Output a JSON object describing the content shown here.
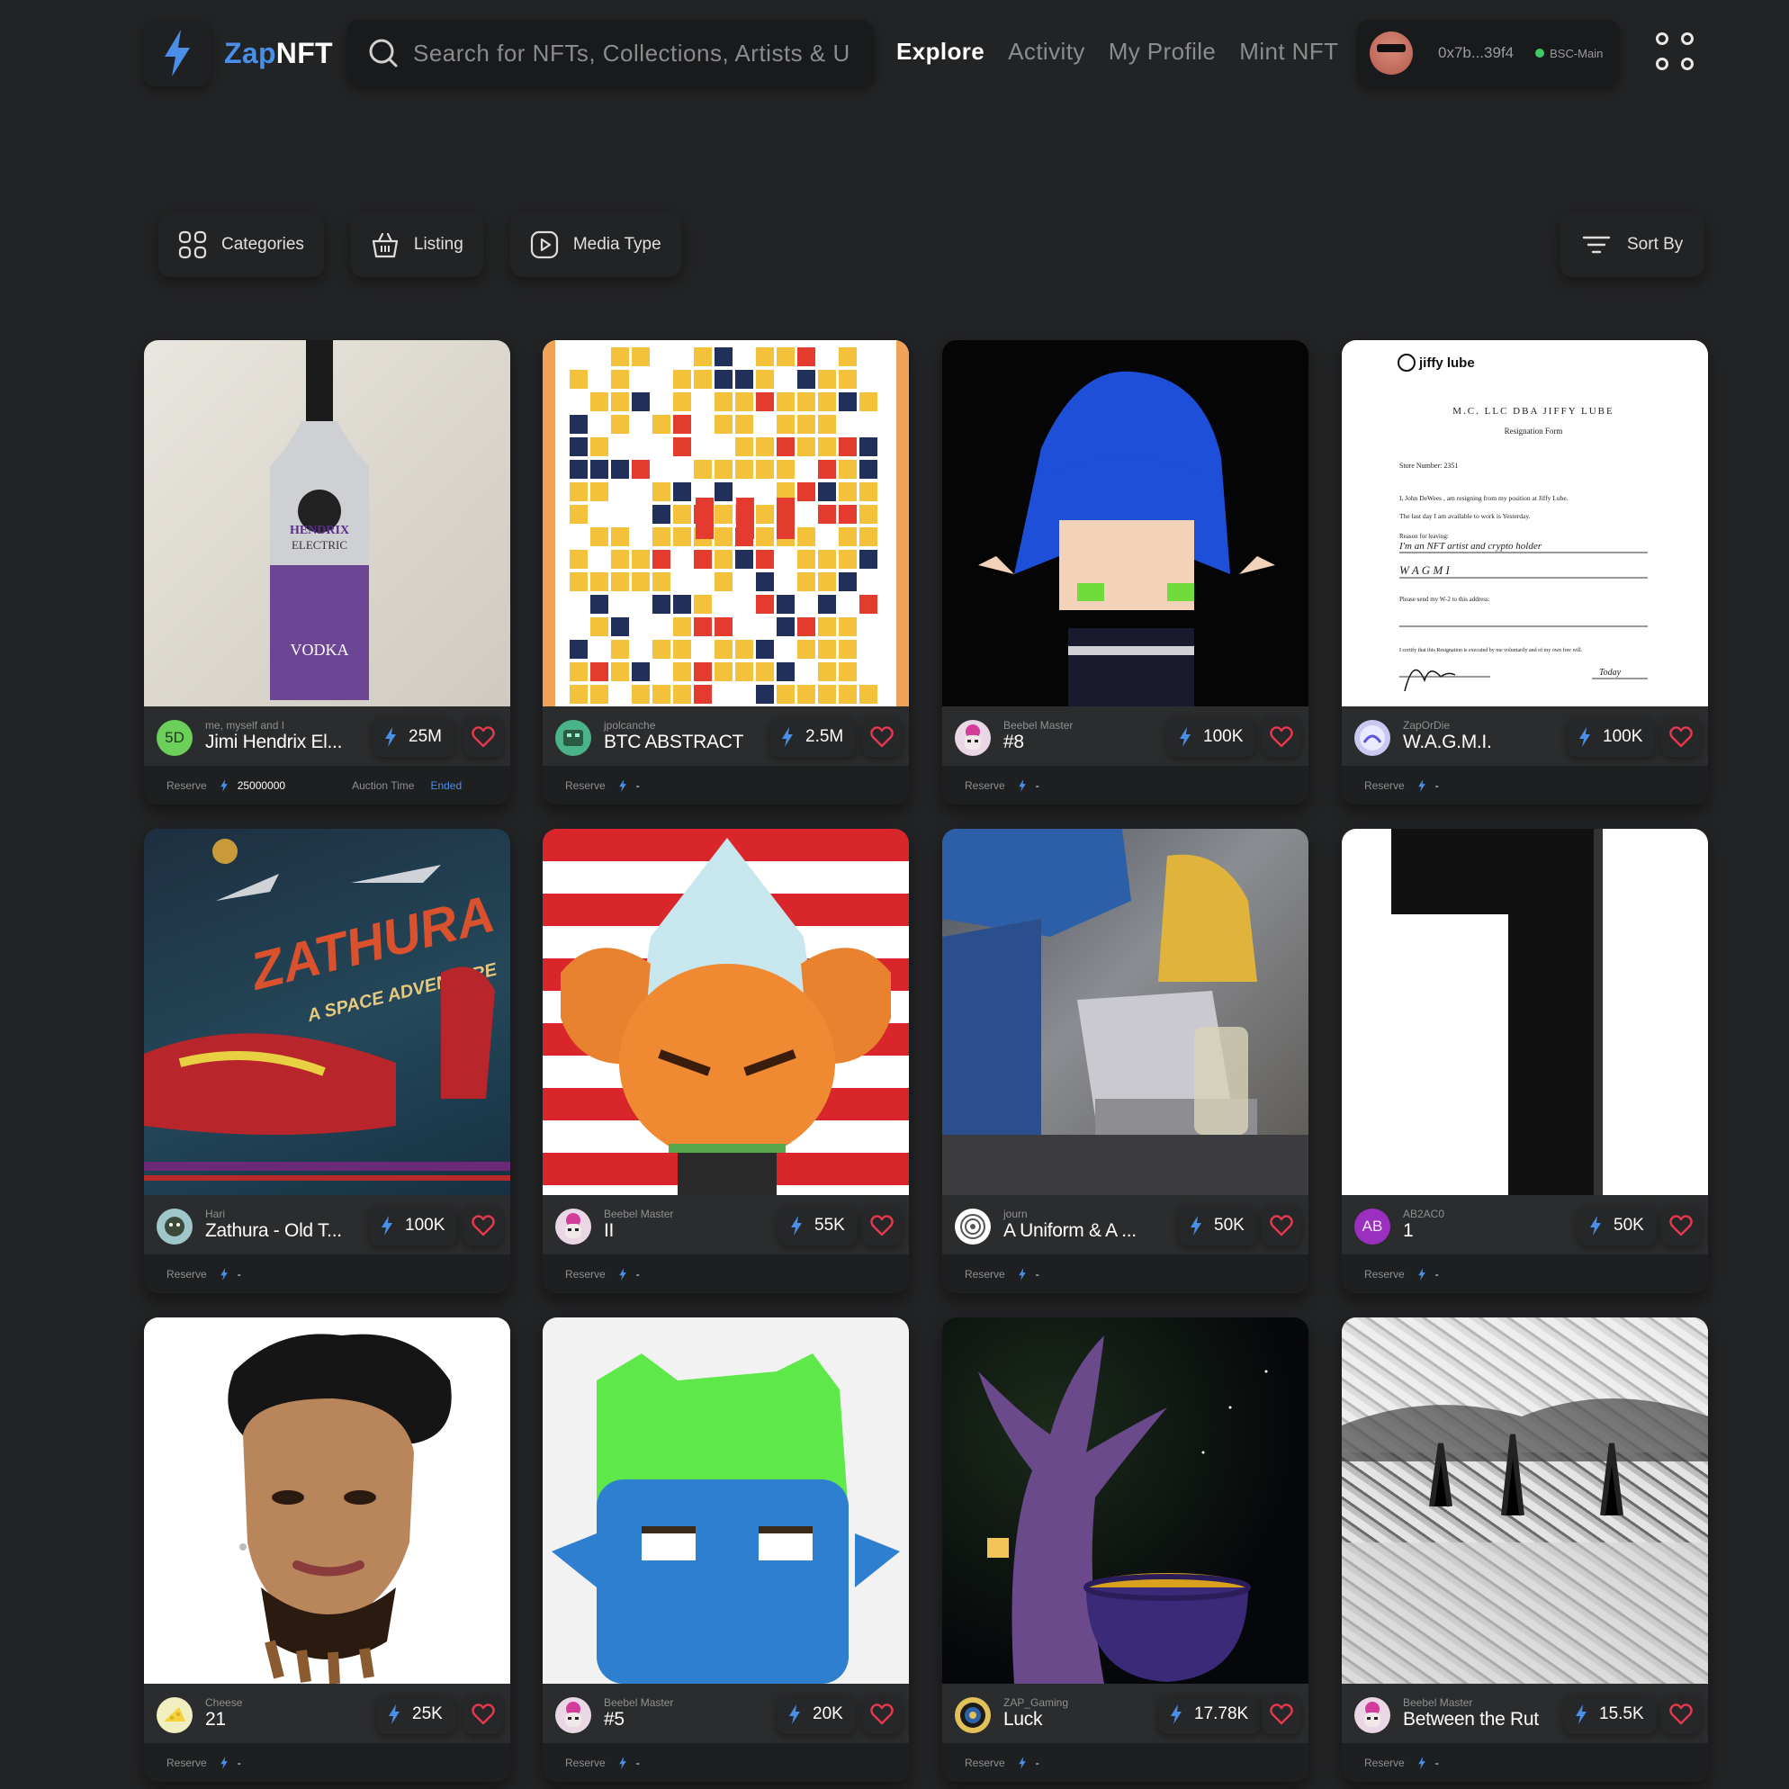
{
  "app": {
    "logo_prefix": "Zap",
    "logo_suffix": "NFT",
    "accent": "#4a8fe7"
  },
  "search": {
    "placeholder": "Search for NFTs, Collections, Artists & U"
  },
  "nav": {
    "explore": "Explore",
    "activity": "Activity",
    "my_profile": "My Profile",
    "mint_nft": "Mint NFT"
  },
  "wallet": {
    "address": "0x7b...39f4",
    "network": "BSC-Main"
  },
  "filters": {
    "categories": "Categories",
    "listing": "Listing",
    "media_type": "Media Type",
    "sort_by": "Sort By"
  },
  "labels": {
    "reserve": "Reserve",
    "auction_time": "Auction Time",
    "ended": "Ended",
    "dash": "-"
  },
  "cards": [
    {
      "creator": "me, myself and I",
      "title": "Jimi Hendrix El...",
      "price": "25M",
      "reserve": "25000000",
      "avatar_text": "5D",
      "avatar_color": "#6ccf5a"
    },
    {
      "creator": "jpolcanche",
      "title": "BTC ABSTRACT",
      "price": "2.5M",
      "reserve": "-",
      "avatar_text": "",
      "avatar_color": "#4bb38a"
    },
    {
      "creator": "Beebel Master",
      "title": "#8",
      "price": "100K",
      "reserve": "-",
      "avatar_text": "",
      "avatar_color": "#e9d7e6"
    },
    {
      "creator": "ZapOrDie",
      "title": "W.A.G.M.I.",
      "price": "100K",
      "reserve": "-",
      "avatar_text": "",
      "avatar_color": "#c9c8f0"
    },
    {
      "creator": "Hari",
      "title": "Zathura - Old T...",
      "price": "100K",
      "reserve": "-",
      "avatar_text": "",
      "avatar_color": "#9fc7c9"
    },
    {
      "creator": "Beebel Master",
      "title": "II",
      "price": "55K",
      "reserve": "-",
      "avatar_text": "",
      "avatar_color": "#e9d7e6"
    },
    {
      "creator": "journ",
      "title": "A Uniform & A ...",
      "price": "50K",
      "reserve": "-",
      "avatar_text": "",
      "avatar_color": "#ffffff"
    },
    {
      "creator": "AB2AC0",
      "title": "1",
      "price": "50K",
      "reserve": "-",
      "avatar_text": "AB",
      "avatar_color": "#9b2fc0"
    },
    {
      "creator": "Cheese",
      "title": "21",
      "price": "25K",
      "reserve": "-",
      "avatar_text": "",
      "avatar_color": "#f1eec0"
    },
    {
      "creator": "Beebel Master",
      "title": "#5",
      "price": "20K",
      "reserve": "-",
      "avatar_text": "",
      "avatar_color": "#e9d7e6"
    },
    {
      "creator": "ZAP_Gaming",
      "title": "Luck",
      "price": "17.78K",
      "reserve": "-",
      "avatar_text": "",
      "avatar_color": "#e3c15a"
    },
    {
      "creator": "Beebel Master",
      "title": "Between the Rut",
      "price": "15.5K",
      "reserve": "-",
      "avatar_text": "",
      "avatar_color": "#e9d7e6"
    }
  ],
  "image_texts": {
    "vodka_brand": "HENDRIX",
    "vodka_sub": "ELECTRIC",
    "vodka_label": "VODKA",
    "zathura_title": "ZATHURA",
    "zathura_sub": "A SPACE ADVENTURE",
    "doc_brand": "jiffy lube",
    "doc_head": "M.C. LLC DBA JIFFY LUBE",
    "doc_sub": "Resignation Form",
    "doc_store": "Store Number: 2351",
    "doc_name": "I, John DeWees , am resigning from my position at Jiffy Lube.",
    "doc_last": "The last day I am available to work is Yesterday.",
    "doc_reason_label": "Reason for leaving:",
    "doc_reason": "I'm an NFT artist and crypto holder",
    "doc_wagmi": "W A G M I",
    "doc_w2": "Please send my W-2 to this address:",
    "doc_certify": "I certify that this Resignation is executed by me voluntarily and of my own free will.",
    "doc_today": "Today",
    "big_one": "1"
  }
}
